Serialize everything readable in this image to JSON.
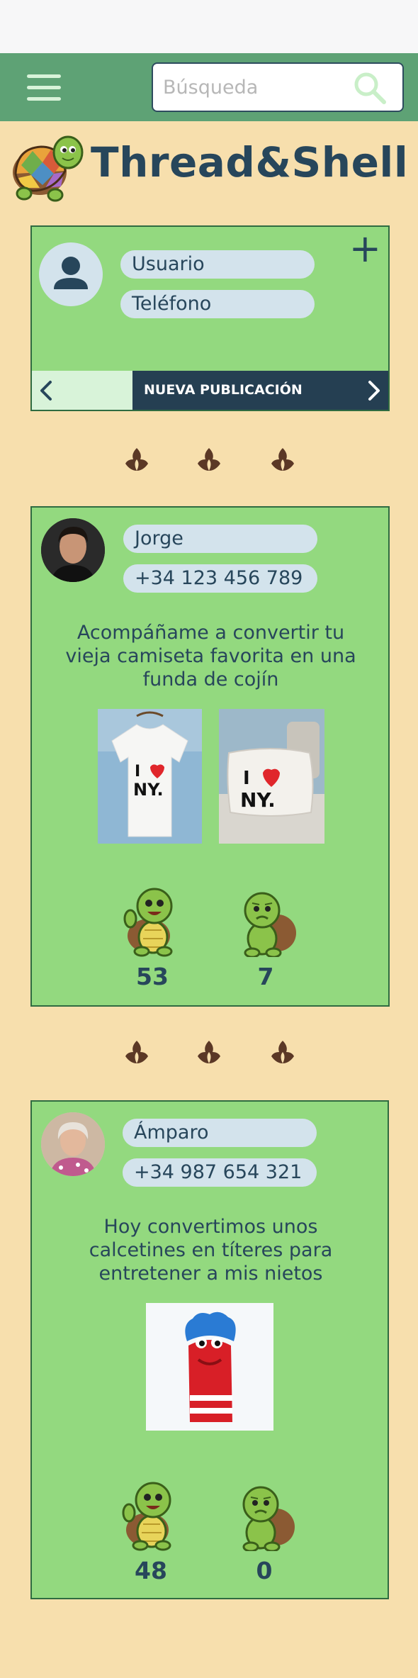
{
  "search": {
    "placeholder": "Búsqueda"
  },
  "brand": {
    "name": "Thread&Shell"
  },
  "composer": {
    "username_placeholder": "Usuario",
    "phone_placeholder": "Teléfono",
    "new_post_label": "NUEVA PUBLICACIÓN"
  },
  "posts": [
    {
      "author": "Jorge",
      "phone": "+34 123 456 789",
      "text": "Acompáñame a convertir tu vieja camiseta favorita en una funda de cojín",
      "likes": "53",
      "dislikes": "7"
    },
    {
      "author": "Ámparo",
      "phone": "+34 987 654 321",
      "text": "Hoy convertimos unos calcetines en títeres para entretener a mis nietos",
      "likes": "48",
      "dislikes": "0"
    }
  ],
  "icons": {
    "menu": "hamburger-icon",
    "search": "search-icon",
    "logo": "turtle-logo",
    "add": "plus-icon",
    "prev": "chevron-left-icon",
    "next": "chevron-right-icon",
    "like": "happy-turtle-icon",
    "dislike": "sad-turtle-icon"
  },
  "colors": {
    "page_bg": "#f7dfad",
    "header_bg": "#5ea275",
    "card_bg": "#93d97f",
    "pill_bg": "#d3e3ec",
    "text_dark": "#27465b",
    "divider_brown": "#5b3826"
  }
}
